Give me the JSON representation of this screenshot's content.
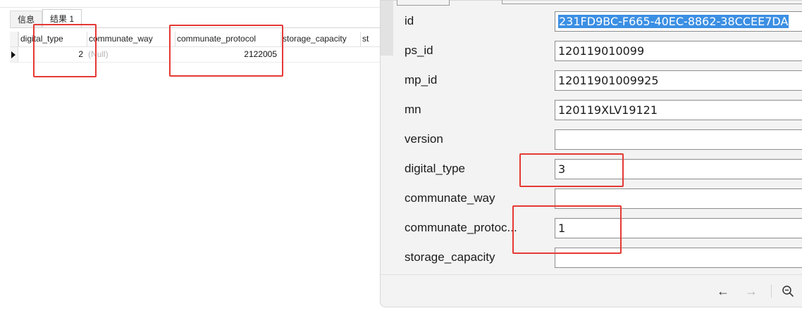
{
  "tabs": [
    {
      "label": "信息"
    },
    {
      "label": "结果 1"
    }
  ],
  "grid": {
    "columns": [
      "digital_type",
      "communate_way",
      "communate_protocol",
      "storage_capacity",
      "st"
    ],
    "rows": [
      {
        "digital_type": "2",
        "communate_way": "(Null)",
        "communate_protocol": "2122005",
        "storage_capacity": "",
        "st": ""
      }
    ]
  },
  "form": {
    "fields": [
      {
        "label": "id",
        "value": "231FD9BC-F665-40EC-8862-38CCEE7DA"
      },
      {
        "label": "ps_id",
        "value": "120119010099"
      },
      {
        "label": "mp_id",
        "value": "12011901009925"
      },
      {
        "label": "mn",
        "value": "120119XLV19121"
      },
      {
        "label": "version",
        "value": ""
      },
      {
        "label": "digital_type",
        "value": "3"
      },
      {
        "label": "communate_way",
        "value": ""
      },
      {
        "label": "communate_protoc...",
        "value": "1"
      },
      {
        "label": "storage_capacity",
        "value": ""
      }
    ],
    "nav": {
      "back_icon": "←",
      "forward_icon": "→"
    }
  },
  "colors": {
    "highlight": "#e53935",
    "selection": "#3b8fe3",
    "null_text": "#b4b4b4"
  }
}
